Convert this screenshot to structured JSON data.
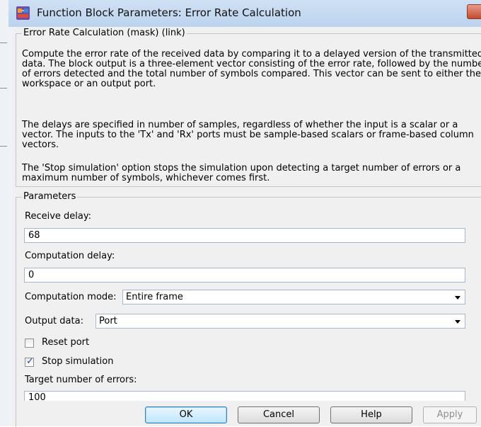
{
  "window": {
    "title": "Function Block Parameters: Error Rate Calculation"
  },
  "mask_group": {
    "legend": "Error Rate Calculation (mask) (link)",
    "description_paragraphs": [
      "Compute the error rate of the received data by comparing it to a delayed version of the transmitted data. The block output is a three-element vector consisting of the error rate, followed by the number of errors detected and the total number of symbols compared. This vector can be sent to either the workspace or an output port.",
      "The delays are specified in number of samples, regardless of whether the input is a scalar or a vector. The inputs to the 'Tx' and 'Rx' ports must be sample-based scalars or frame-based column vectors.",
      "The 'Stop simulation' option stops the simulation upon detecting a target number of errors or a maximum number of symbols, whichever comes first."
    ]
  },
  "parameters": {
    "legend": "Parameters",
    "receive_delay": {
      "label": "Receive delay:",
      "value": "68"
    },
    "computation_delay": {
      "label": "Computation delay:",
      "value": "0"
    },
    "computation_mode": {
      "label": "Computation mode:",
      "value": "Entire frame"
    },
    "output_data": {
      "label": "Output data:",
      "value": "Port"
    },
    "reset_port": {
      "label": "Reset port",
      "checked": false
    },
    "stop_simulation": {
      "label": "Stop simulation",
      "checked": true
    },
    "target_errors": {
      "label": "Target number of errors:",
      "value": "100"
    }
  },
  "buttons": {
    "ok": "OK",
    "cancel": "Cancel",
    "help": "Help",
    "apply": "Apply"
  },
  "colors": {
    "titlebar": "#c4d8f0",
    "dialog_background": "#f0f0f0",
    "checkmark": "#1f4a9c"
  },
  "icons": {
    "app": "simulink-block-icon",
    "close": "close-icon"
  }
}
